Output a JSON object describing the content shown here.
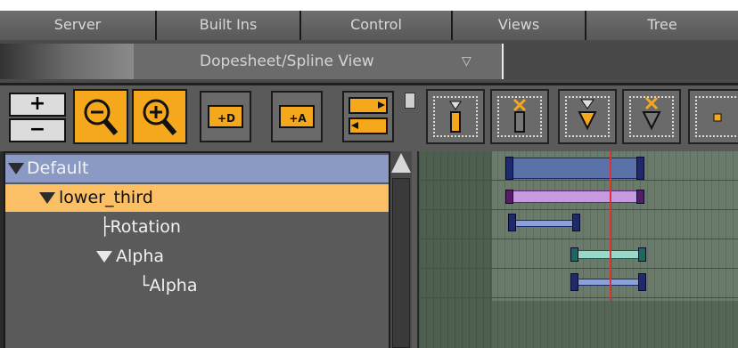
{
  "menu": {
    "tabs": [
      "Server",
      "Built Ins",
      "Control",
      "Views",
      "Tree"
    ]
  },
  "view_selector": {
    "label": "Dopesheet/Spline View",
    "arrow_icon": "triangle-down-icon"
  },
  "toolbar": {
    "zoom_in_label": "+",
    "zoom_out_label": "−",
    "right_buttons": [
      "add-key-icon",
      "delete-key-icon",
      "add-key-all-icon",
      "delete-key-all-icon",
      "key-square-icon"
    ]
  },
  "tree": {
    "items": [
      {
        "label": "Default",
        "level": 0
      },
      {
        "label": "lower_third",
        "level": 1
      },
      {
        "label": "├Rotation",
        "level": 2
      },
      {
        "label": "Alpha",
        "level": 2
      },
      {
        "label": "└Alpha",
        "level": 3
      }
    ]
  },
  "colors": {
    "selected_scene": "#8a9ac4",
    "selected_container": "#fbc065",
    "toolbar_orange": "#f6a81d",
    "playhead": "#e03030"
  }
}
